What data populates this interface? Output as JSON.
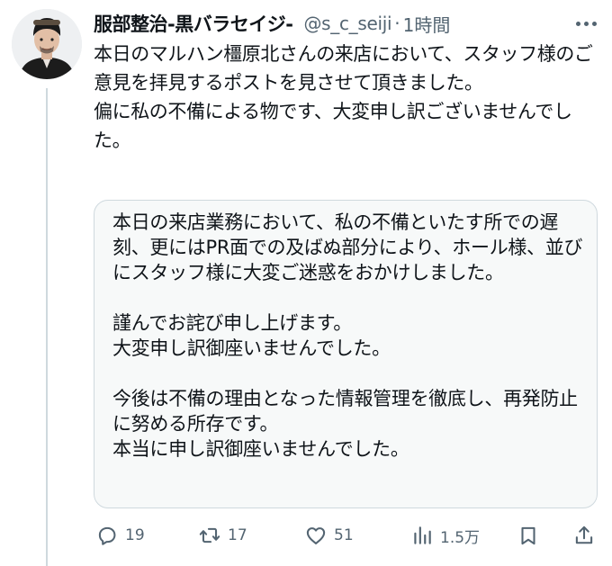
{
  "tweet": {
    "display_name": "服部整治-黒バラセイジ-",
    "handle": "@s_c_seiji",
    "separator": "·",
    "time": "1時間",
    "text": "本日のマルハン橿原北さんの来店において、スタッフ様のご意見を拝見するポストを見させて頂きました。\n偏に私の不備による物です、大変申し訳ございませんでした。"
  },
  "quote": {
    "text": "本日の来店業務において、私の不備といたす所での遅刻、更にはPR面での及ばぬ部分により、ホール様、並びにスタッフ様に大変ご迷惑をおかけしました。\n\n謹んでお詫び申し上げます。\n大変申し訳御座いませんでした。\n\n今後は不備の理由となった情報管理を徹底し、再発防止に努める所存です。\n本当に申し訳御座いませんでした。"
  },
  "actions": {
    "replies": "19",
    "reposts": "17",
    "likes": "51",
    "views": "1.5万"
  },
  "icons": {
    "reply": "reply-icon",
    "repost": "repost-icon",
    "like": "heart-icon",
    "views": "views-icon",
    "bookmark": "bookmark-icon",
    "share": "share-icon",
    "more": "more-icon"
  },
  "colors": {
    "text": "#0f1419",
    "secondary": "#536471",
    "border": "#cfd9de",
    "quote_bg": "#f7f9f9"
  }
}
